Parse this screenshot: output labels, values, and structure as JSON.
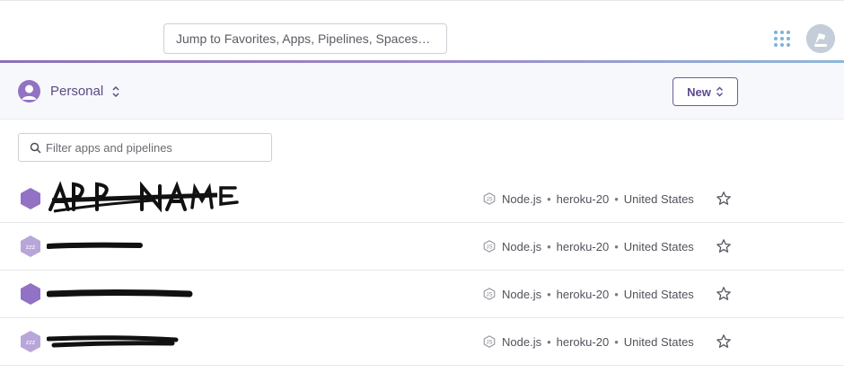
{
  "header": {
    "search_placeholder": "Jump to Favorites, Apps, Pipelines, Spaces…"
  },
  "subheader": {
    "team_name": "Personal",
    "new_label": "New"
  },
  "filter": {
    "placeholder": "Filter apps and pipelines"
  },
  "apps": [
    {
      "name": "APP NAME",
      "stack_lang": "Node.js",
      "stack": "heroku-20",
      "region": "United States",
      "sleeping": false
    },
    {
      "name": "",
      "stack_lang": "Node.js",
      "stack": "heroku-20",
      "region": "United States",
      "sleeping": true
    },
    {
      "name": "",
      "stack_lang": "Node.js",
      "stack": "heroku-20",
      "region": "United States",
      "sleeping": false
    },
    {
      "name": "",
      "stack_lang": "Node.js",
      "stack": "heroku-20",
      "region": "United States",
      "sleeping": true
    }
  ],
  "sleeping_icon_text": "zzz",
  "colors": {
    "accent_purple": "#79589f",
    "app_hex": "#9272c4",
    "app_hex_sleeping": "#b9a6d8",
    "apps_grid_blue": "#7fb3d9"
  }
}
